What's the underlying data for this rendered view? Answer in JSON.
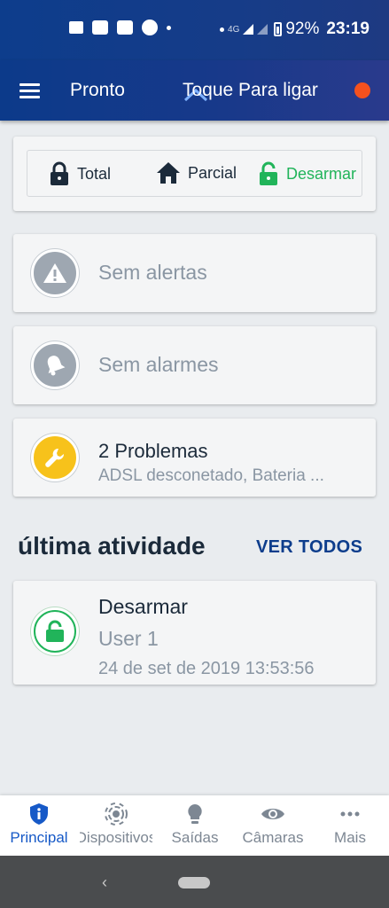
{
  "status_bar": {
    "network": "4G",
    "battery": "92%",
    "time": "23:19"
  },
  "app_bar": {
    "title": "Pronto",
    "connect_label": "Toque Para ligar",
    "status_color": "#f4511e"
  },
  "arm_panel": {
    "total": "Total",
    "parcial": "Parcial",
    "desarmar": "Desarmar"
  },
  "alerts": {
    "label": "Sem alertas",
    "icon": "warning-icon"
  },
  "alarms": {
    "label": "Sem alarmes",
    "icon": "bell-icon"
  },
  "problems": {
    "title": "2 Problemas",
    "subtitle": "ADSL desconetado, Bateria ...",
    "icon": "wrench-icon",
    "color": "#f7c21b"
  },
  "activity": {
    "section_title": "última atividade",
    "see_all": "VER TODOS",
    "items": [
      {
        "title": "Desarmar",
        "user": "User 1",
        "date": "24 de set de 2019 13:53:56"
      }
    ]
  },
  "bottom_nav": [
    {
      "label": "Principal",
      "icon": "shield-info-icon",
      "active": true
    },
    {
      "label": "Dispositivos",
      "icon": "sensor-icon",
      "active": false
    },
    {
      "label": "Saídas",
      "icon": "bulb-icon",
      "active": false
    },
    {
      "label": "Câmaras",
      "icon": "eye-icon",
      "active": false
    },
    {
      "label": "Mais",
      "icon": "dots-icon",
      "active": false
    }
  ],
  "colors": {
    "primary": "#0d3d8c",
    "active_nav": "#1659c7",
    "green": "#21b45a"
  }
}
